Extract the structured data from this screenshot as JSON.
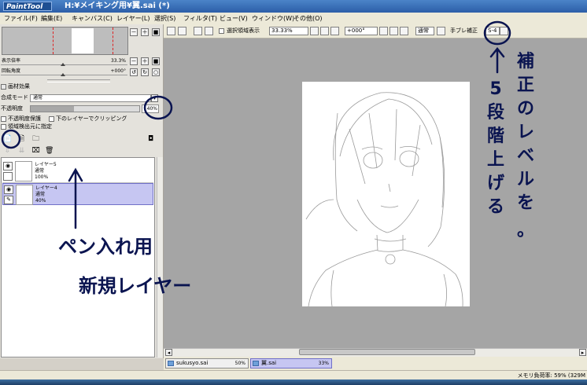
{
  "titlebar": {
    "logo_text": "PaintTool SAI",
    "title": "H:¥メイキング用¥翼.sai (*)"
  },
  "menu": [
    "ファイル(F)",
    "編集(E)",
    "キャンバス(C)",
    "レイヤー(L)",
    "選択(S)",
    "フィルタ(T)",
    "ビュー(V)",
    "ウィンドウ(W)",
    "その他(O)"
  ],
  "navigator": {
    "zoom_label": "表示倍率",
    "zoom_value": "33.3%",
    "rotation_label": "回転角度",
    "rotation_value": "+000°"
  },
  "layer_props": {
    "texture_label": "画材効果",
    "blend_label": "合成モード",
    "blend_value": "通常",
    "opacity_label": "不透明度",
    "opacity_value": "40%",
    "opacity_fraction": 0.4,
    "preserve_opacity_label": "不透明度保護",
    "clip_label": "下のレイヤーでクリッピング",
    "selection_source_label": "領域検出元に指定"
  },
  "layers": [
    {
      "name": "レイヤー5",
      "mode": "通常",
      "opacity": "100%",
      "selected": false
    },
    {
      "name": "レイヤー4",
      "mode": "通常",
      "opacity": "40%",
      "selected": true
    }
  ],
  "toolbar": {
    "show_selection_label": "選択領域表示",
    "zoom_value": "33.33%",
    "rotation_value": "+000°",
    "blend_value": "通常",
    "stabilizer_label": "手ブレ補正",
    "stabilizer_value": "S-4"
  },
  "document_tabs": [
    {
      "name": "sukusyo.sai",
      "zoom": "50%",
      "active": false
    },
    {
      "name": "翼.sai",
      "zoom": "33%",
      "active": true
    }
  ],
  "statusbar": {
    "memory": "メモリ負荷率: 59% (329M"
  },
  "annotations": {
    "stabilizer_note": "補正のレベルを5段階上げる。",
    "newlayer_line1": "ペン入れ用",
    "newlayer_line2": "新規レイヤー"
  },
  "colors": {
    "titlebar": "#2c5ea8",
    "canvas_bg": "#a5a5a5",
    "selected_layer": "#c6c6f2",
    "annotation_ink": "#0a1450"
  }
}
